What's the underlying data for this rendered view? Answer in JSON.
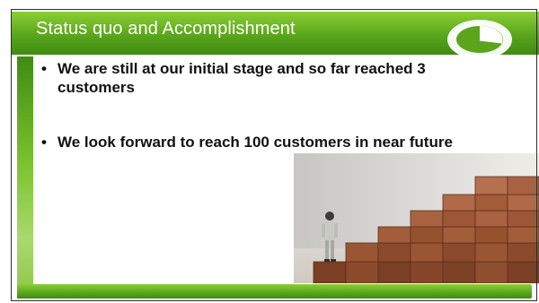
{
  "slide": {
    "title": "Status quo and Accomplishment",
    "bullets": [
      "We are still at our initial stage and so far reached 3 customers",
      "We look forward to reach 100 customers in near future"
    ],
    "bullet_symbol": "•"
  },
  "colors": {
    "accent_green": "#5aa51c",
    "light_green": "#8bcf34",
    "dark_green": "#3f8c12",
    "text": "#111111"
  },
  "icons": {
    "logo": "pie-chart-logo-icon",
    "photo": "figurine-on-wooden-staircase-image"
  }
}
